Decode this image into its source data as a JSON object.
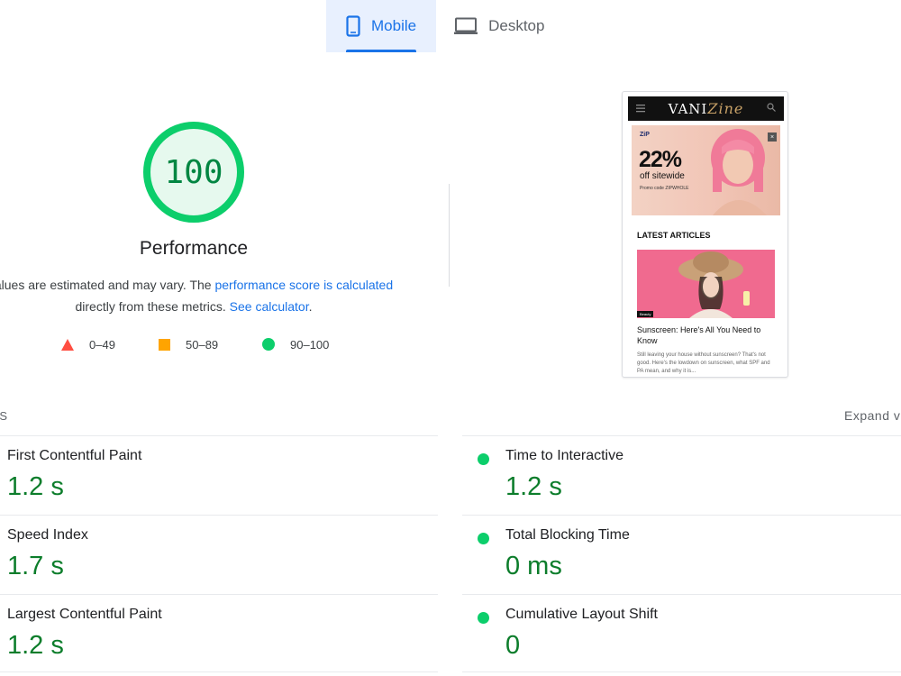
{
  "tabs": [
    {
      "label": "Mobile",
      "icon": "mobile-icon",
      "active": true
    },
    {
      "label": "Desktop",
      "icon": "desktop-icon",
      "active": false
    }
  ],
  "score": {
    "value": "100",
    "fraction": 1.0,
    "title": "Performance",
    "desc_prefix": "alues are estimated and may vary. The ",
    "desc_link": "performance score is calculated",
    "desc_middle": "directly from these metrics. ",
    "desc_link2": "See calculator",
    "desc_suffix": ".",
    "color": "#0cce6b"
  },
  "legend": [
    {
      "range": "0–49",
      "icon": "fail-triangle-icon",
      "color": "#ff4e42"
    },
    {
      "range": "50–89",
      "icon": "average-square-icon",
      "color": "#ffa400"
    },
    {
      "range": "90–100",
      "icon": "pass-circle-icon",
      "color": "#0cce6b"
    }
  ],
  "screenshot": {
    "logo_main": "VANI",
    "logo_script": "Zine",
    "ad_brand": "ZiP",
    "ad_percent": "22%",
    "ad_off": "off sitewide",
    "ad_small": "Promo code ZIPWHOLE",
    "section": "LATEST ARTICLES",
    "tag": "Beauty",
    "article_title": "Sunscreen: Here's All You Need to Know",
    "article_excerpt": "Still leaving your house without sunscreen? That's not good. Here's the lowdown on sunscreen, what SPF and PA mean, and why it is..."
  },
  "metrics": {
    "header": "RICS",
    "expand": "Expand view",
    "items": [
      {
        "name": "First Contentful Paint",
        "value": "1.2 s"
      },
      {
        "name": "Time to Interactive",
        "value": "1.2 s"
      },
      {
        "name": "Speed Index",
        "value": "1.7 s"
      },
      {
        "name": "Total Blocking Time",
        "value": "0 ms"
      },
      {
        "name": "Largest Contentful Paint",
        "value": "1.2 s"
      },
      {
        "name": "Cumulative Layout Shift",
        "value": "0"
      }
    ]
  },
  "colors": {
    "accent": "#1a73e8",
    "pass": "#0cce6b",
    "pass_text": "#0c7d2b"
  }
}
